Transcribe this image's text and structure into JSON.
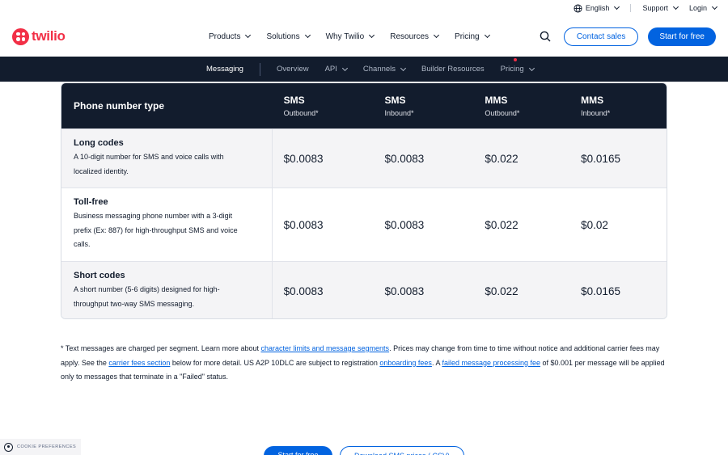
{
  "utility": {
    "language": "English",
    "support": "Support",
    "login": "Login"
  },
  "brand": {
    "name": "twilio",
    "color": "#f22f46"
  },
  "nav": {
    "items": [
      {
        "label": "Products"
      },
      {
        "label": "Solutions"
      },
      {
        "label": "Why Twilio"
      },
      {
        "label": "Resources"
      },
      {
        "label": "Pricing"
      }
    ],
    "contact_sales": "Contact sales",
    "start_free": "Start for free"
  },
  "subnav": {
    "title": "Messaging",
    "items": [
      {
        "label": "Overview"
      },
      {
        "label": "API"
      },
      {
        "label": "Channels"
      },
      {
        "label": "Builder Resources"
      },
      {
        "label": "Pricing"
      }
    ]
  },
  "table": {
    "header": {
      "first": "Phone number type",
      "cols": [
        {
          "title": "SMS",
          "sub": "Outbound*"
        },
        {
          "title": "SMS",
          "sub": "Inbound*"
        },
        {
          "title": "MMS",
          "sub": "Outbound*"
        },
        {
          "title": "MMS",
          "sub": "Inbound*"
        }
      ]
    },
    "rows": [
      {
        "title": "Long codes",
        "desc_lines": [
          "A 10-digit number for SMS and voice calls with",
          "localized identity."
        ],
        "values": [
          "$0.0083",
          "$0.0083",
          "$0.022",
          "$0.0165"
        ]
      },
      {
        "title": "Toll-free",
        "desc_lines": [
          "Business messaging phone number with a 3-digit",
          "prefix (Ex: 887) for high-throughput SMS and voice",
          "calls."
        ],
        "values": [
          "$0.0083",
          "$0.0083",
          "$0.022",
          "$0.02"
        ]
      },
      {
        "title": "Short codes",
        "desc_lines": [
          "A short number (5-6 digits) designed for high-",
          "throughput two-way SMS messaging."
        ],
        "values": [
          "$0.0083",
          "$0.0083",
          "$0.022",
          "$0.0165"
        ]
      }
    ]
  },
  "footnote": {
    "t1": "* Text messages are charged per segment. Learn more about ",
    "link1": "character limits and message segments",
    "t2": ". Prices may change from time to time without notice and additional carrier fees may apply. See the ",
    "link2": "carrier fees section",
    "t3": " below for more detail. US A2P 10DLC are subject to registration ",
    "link3": "onboarding fees",
    "t4": ". A ",
    "link4": "failed message processing fee",
    "t5": " of $0.001 per message will be applied only to messages that terminate in a \"Failed\" status."
  },
  "cookie": {
    "label": "COOKIE PREFERENCES"
  },
  "bottom": {
    "start_free": "Start for free",
    "download": "Download SMS prices (.CSV)"
  }
}
